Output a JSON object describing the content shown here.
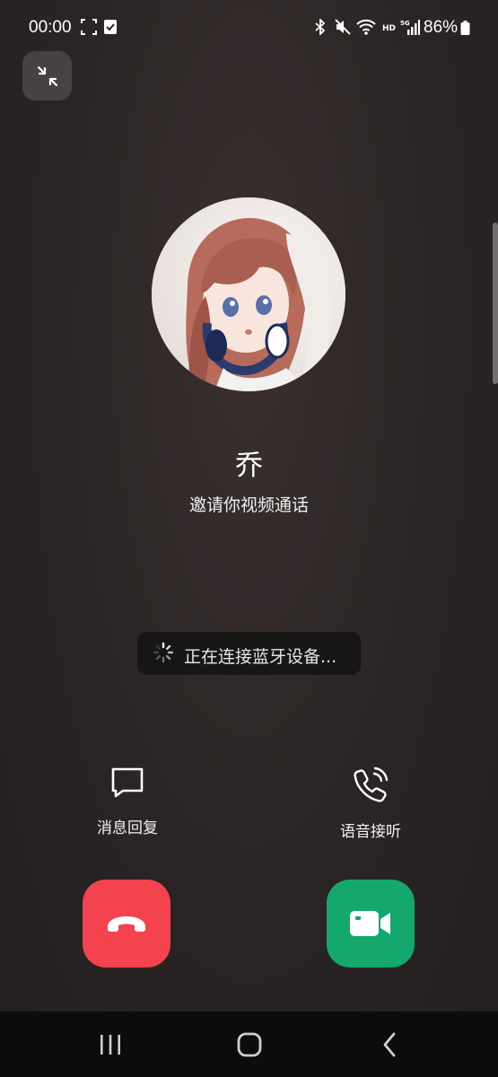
{
  "status_bar": {
    "time": "00:00",
    "battery_percent": "86%",
    "icons": [
      "screenshot-icon",
      "checkbox-notification-icon",
      "bluetooth-icon",
      "mute-icon",
      "wifi-icon",
      "hd-icon",
      "5g-signal-icon",
      "battery-icon"
    ]
  },
  "caller": {
    "name": "乔",
    "status": "邀请你视频通话"
  },
  "toast": {
    "text": "正在连接蓝牙设备..."
  },
  "options": {
    "message_reply": "消息回复",
    "voice_answer": "语音接听"
  },
  "colors": {
    "decline": "#f2434f",
    "accept": "#14a86e",
    "background": "#2c2626"
  }
}
